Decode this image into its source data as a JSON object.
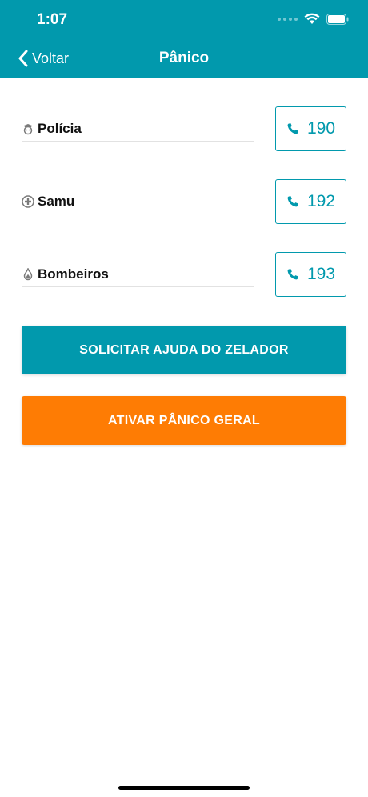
{
  "status_bar": {
    "time": "1:07"
  },
  "nav": {
    "back_label": "Voltar",
    "title": "Pânico"
  },
  "contacts": [
    {
      "label": "Polícia",
      "icon": "police-icon",
      "number": "190"
    },
    {
      "label": "Samu",
      "icon": "medical-cross-icon",
      "number": "192"
    },
    {
      "label": "Bombeiros",
      "icon": "fire-icon",
      "number": "193"
    }
  ],
  "actions": {
    "zelador_label": "SOLICITAR AJUDA DO ZELADOR",
    "panico_label": "ATIVAR PÂNICO GERAL"
  },
  "colors": {
    "primary": "#0199ad",
    "panic": "#fe7c04",
    "background": "#ffffff"
  }
}
